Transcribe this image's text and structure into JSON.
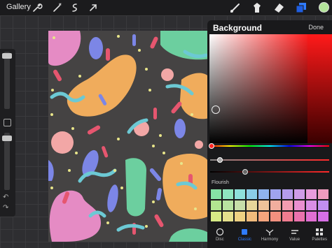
{
  "topbar": {
    "gallery_label": "Gallery",
    "left_tools": [
      "wrench-icon",
      "magic-wand-icon",
      "selection-icon",
      "transform-arrow-icon"
    ],
    "right_tools": [
      "brush-icon",
      "smudge-icon",
      "eraser-icon",
      "layers-icon"
    ],
    "current_color": "#b3e39a"
  },
  "panel": {
    "title": "Background",
    "done_label": "Done",
    "palette_name": "Flourish",
    "palette_colors": [
      "#86e3a6",
      "#8ee6c0",
      "#8ee0dc",
      "#8bcde8",
      "#8fb3ee",
      "#9fa3ef",
      "#b49cec",
      "#cf9ce8",
      "#e89cdc",
      "#f09cbf",
      "#b2e690",
      "#b9e3a0",
      "#c7dfa9",
      "#e6d69a",
      "#eec39a",
      "#f0ae9e",
      "#f29cb1",
      "#e98fd0",
      "#d98ee6",
      "#c28ef0",
      "#d6ea86",
      "#e5e08c",
      "#efd183",
      "#f1bb7c",
      "#f3a47d",
      "#f2907f",
      "#f07c8f",
      "#ea72ad",
      "#e06fd2",
      "#d66fe6"
    ],
    "tabs": [
      {
        "label": "Disc",
        "icon": "disc-icon"
      },
      {
        "label": "Classic",
        "icon": "classic-icon"
      },
      {
        "label": "Harmony",
        "icon": "harmony-icon"
      },
      {
        "label": "Value",
        "icon": "value-icon"
      },
      {
        "label": "Palettes",
        "icon": "palettes-icon"
      }
    ],
    "active_tab": "Classic",
    "accent": "#2f7bff"
  },
  "artwork": {
    "background_color": "#454343",
    "shape_colors": [
      "#f0ac5c",
      "#6ccf9f",
      "#e58bc4",
      "#7c86e6",
      "#e6566f",
      "#6cc9d4",
      "#f2a7a6",
      "#e8e58a"
    ]
  }
}
